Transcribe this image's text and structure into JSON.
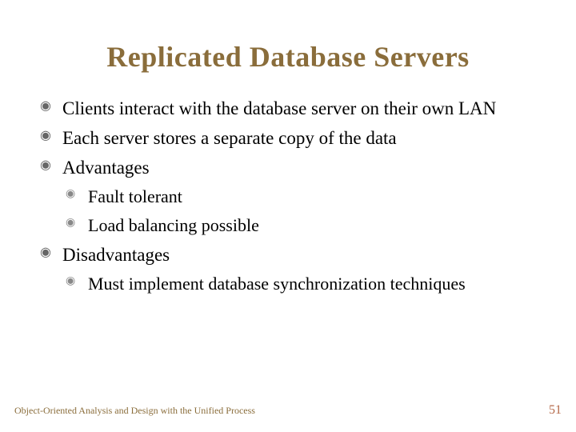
{
  "title": "Replicated Database Servers",
  "bullets": {
    "b1": "Clients interact with the database server on their own LAN",
    "b2": "Each server stores a separate copy of the data",
    "b3": "Advantages",
    "b3a": "Fault tolerant",
    "b3b": "Load balancing possible",
    "b4": "Disadvantages",
    "b4a": "Must implement database synchronization techniques"
  },
  "footer": {
    "text": "Object-Oriented Analysis and Design with the Unified Process",
    "page": "51"
  }
}
